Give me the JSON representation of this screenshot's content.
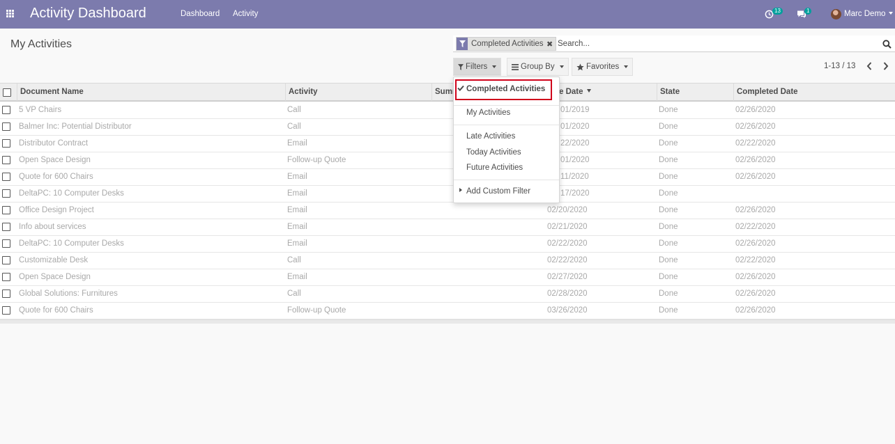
{
  "navbar": {
    "app_title": "Activity Dashboard",
    "menu": [
      "Dashboard",
      "Activity"
    ],
    "activity_count": "13",
    "message_count": "1",
    "user_name": "Marc Demo",
    "bg_color": "#7c7bad"
  },
  "control_panel": {
    "breadcrumb": "My Activities",
    "search": {
      "facet_label": "Completed Activities",
      "placeholder": "Search..."
    },
    "buttons": {
      "filters": "Filters",
      "group_by": "Group By",
      "favorites": "Favorites"
    },
    "pager": "1-13 / 13"
  },
  "filters_menu": {
    "selected": "Completed Activities",
    "items": [
      "My Activities",
      "Late Activities",
      "Today Activities",
      "Future Activities"
    ],
    "custom": "Add Custom Filter"
  },
  "table": {
    "columns": {
      "document": "Document Name",
      "activity": "Activity",
      "summary": "Summ",
      "due_date": "e Date",
      "state": "State",
      "completed": "Completed Date"
    },
    "rows": [
      {
        "document": "5 VP Chairs",
        "activity": "Call",
        "due": "01/2019",
        "state": "Done",
        "completed": "02/26/2020"
      },
      {
        "document": "Balmer Inc: Potential Distributor",
        "activity": "Call",
        "due": "01/2020",
        "state": "Done",
        "completed": "02/26/2020"
      },
      {
        "document": "Distributor Contract",
        "activity": "Email",
        "due": "22/2020",
        "state": "Done",
        "completed": "02/22/2020"
      },
      {
        "document": "Open Space Design",
        "activity": "Follow-up Quote",
        "due": "01/2020",
        "state": "Done",
        "completed": "02/26/2020"
      },
      {
        "document": "Quote for 600 Chairs",
        "activity": "Email",
        "due": "11/2020",
        "state": "Done",
        "completed": "02/26/2020"
      },
      {
        "document": "DeltaPC: 10 Computer Desks",
        "activity": "Email",
        "due": "17/2020",
        "state": "Done",
        "completed": ""
      },
      {
        "document": "Office Design Project",
        "activity": "Email",
        "due": "02/20/2020",
        "state": "Done",
        "completed": "02/26/2020"
      },
      {
        "document": "Info about services",
        "activity": "Email",
        "due": "02/21/2020",
        "state": "Done",
        "completed": "02/22/2020"
      },
      {
        "document": "DeltaPC: 10 Computer Desks",
        "activity": "Email",
        "due": "02/22/2020",
        "state": "Done",
        "completed": "02/26/2020"
      },
      {
        "document": "Customizable Desk",
        "activity": "Call",
        "due": "02/22/2020",
        "state": "Done",
        "completed": "02/22/2020"
      },
      {
        "document": "Open Space Design",
        "activity": "Email",
        "due": "02/27/2020",
        "state": "Done",
        "completed": "02/26/2020"
      },
      {
        "document": "Global Solutions: Furnitures",
        "activity": "Call",
        "due": "02/28/2020",
        "state": "Done",
        "completed": "02/26/2020"
      },
      {
        "document": "Quote for 600 Chairs",
        "activity": "Follow-up Quote",
        "due": "03/26/2020",
        "state": "Done",
        "completed": "02/26/2020"
      }
    ]
  }
}
